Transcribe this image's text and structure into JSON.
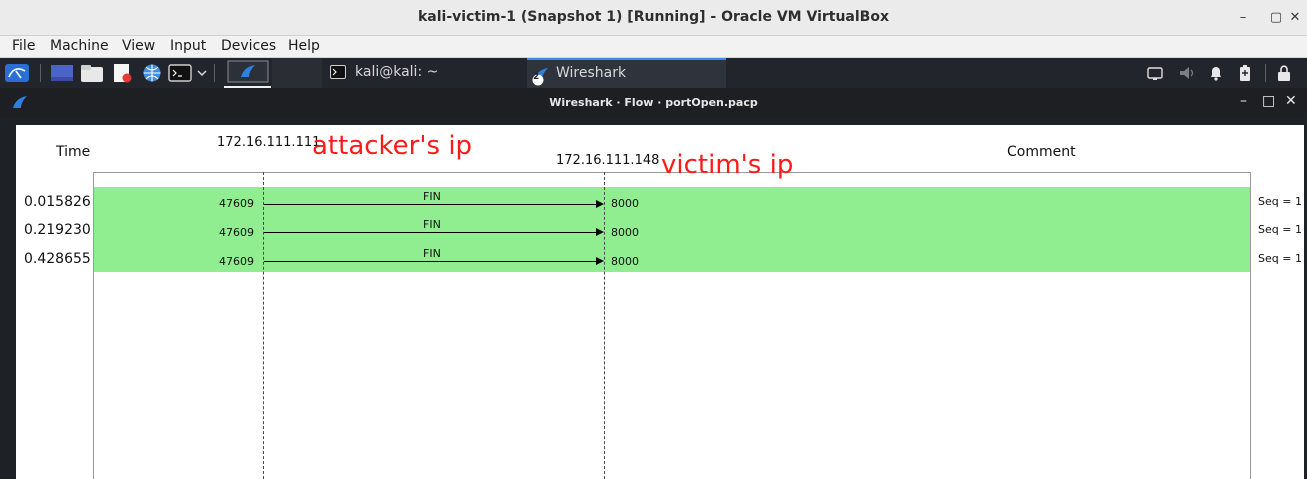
{
  "window": {
    "title": "kali-victim-1 (Snapshot 1) [Running] - Oracle VM VirtualBox",
    "minimize": "–",
    "maximize": "▢",
    "close": "✕"
  },
  "menubar": {
    "items": [
      "File",
      "Machine",
      "View",
      "Input",
      "Devices",
      "Help"
    ]
  },
  "taskbar": {
    "terminal_task": "kali@kali: ~",
    "wireshark_task": "Wireshark",
    "wireshark_badge": "2"
  },
  "wireshark_window": {
    "title": "Wireshark · Flow · portOpen.pacp",
    "minimize": "–",
    "maximize": "□",
    "close": "✕"
  },
  "flow": {
    "header_time": "Time",
    "header_comment": "Comment",
    "node_a": "172.16.111.111",
    "node_b": "172.16.111.148",
    "annotation_a": "attacker's ip",
    "annotation_b": "victim's ip",
    "rows": [
      {
        "time": "0.015826",
        "src_port": "47609",
        "dst_port": "8000",
        "label": "FIN",
        "comment": "Seq = 1"
      },
      {
        "time": "0.219230",
        "src_port": "47609",
        "dst_port": "8000",
        "label": "FIN",
        "comment": "Seq = 1"
      },
      {
        "time": "0.428655",
        "src_port": "47609",
        "dst_port": "8000",
        "label": "FIN",
        "comment": "Seq = 1"
      }
    ],
    "row_color": "#90ee90"
  }
}
